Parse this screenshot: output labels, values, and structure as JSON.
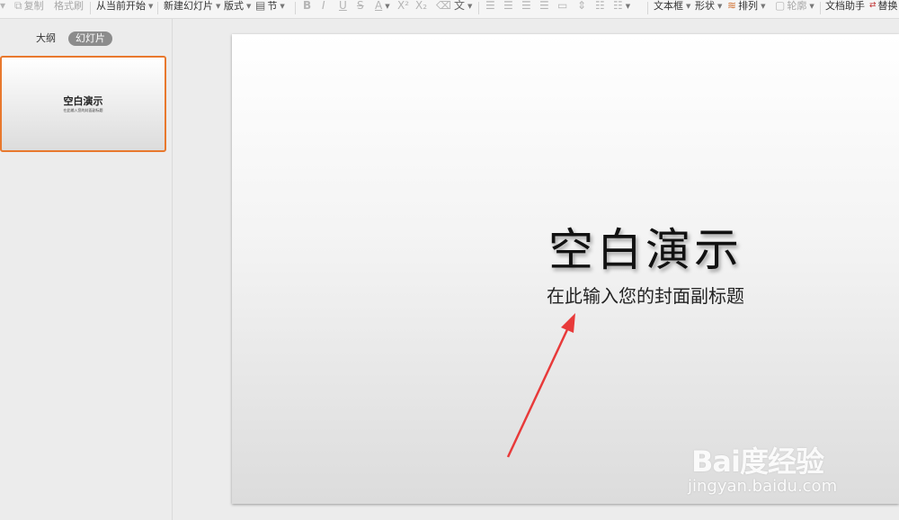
{
  "toolbar": {
    "copy": "复制",
    "format_painter": "格式刷",
    "from_current": "从当前开始",
    "new_slide": "新建幻灯片",
    "layout": "版式",
    "section": "节",
    "bold": "B",
    "italic": "I",
    "underline": "U",
    "strike": "S",
    "font_color": "A",
    "superscript": "X²",
    "subscript": "X₂",
    "clear": "⌫",
    "text_char": "文",
    "textbox": "文本框",
    "shape": "形状",
    "arrange": "排列",
    "outline": "轮廓",
    "doc_helper": "文档助手",
    "replace": "替换"
  },
  "left_pane": {
    "tab_outline": "大纲",
    "tab_slides": "幻灯片",
    "thumb_title": "空白演示",
    "thumb_subtitle": "在此输入您的封面副标题"
  },
  "slide": {
    "title": "空白演示",
    "subtitle": "在此输入您的封面副标题"
  },
  "watermark": {
    "logo_text": "Bai度经验",
    "url": "jingyan.baidu.com"
  },
  "colors": {
    "selection_border": "#e8782d",
    "annotation_arrow": "#e83a3a"
  }
}
